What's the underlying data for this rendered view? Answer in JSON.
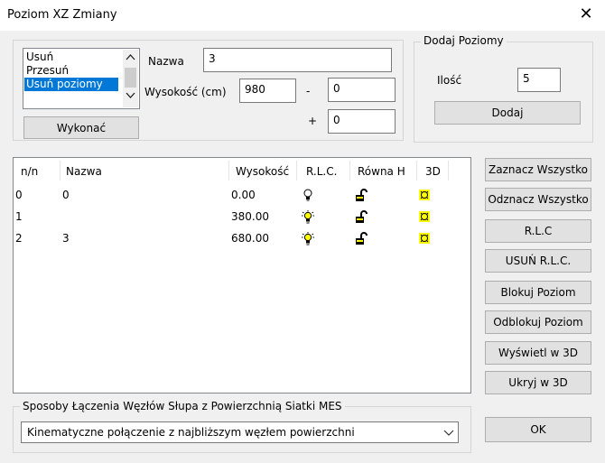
{
  "window": {
    "title": "Poziom XZ Zmiany",
    "close_glyph": "✕"
  },
  "ops": {
    "items": [
      "Usuń",
      "Przesuń",
      "Usuń poziomy"
    ],
    "selected_index": 2,
    "execute_label": "Wykonać"
  },
  "fields": {
    "name_label": "Nazwa",
    "name_value": "3",
    "height_label": "Wysokość (cm)",
    "height_value": "980",
    "minus_label": "-",
    "minus_value": "0",
    "plus_label": "+",
    "plus_value": "0"
  },
  "add_levels": {
    "group_label": "Dodaj Poziomy",
    "count_label": "Ilość",
    "count_value": "5",
    "add_label": "Dodaj"
  },
  "table": {
    "headers": {
      "nn": "n/n",
      "name": "Nazwa",
      "height": "Wysokość",
      "rlc": "R.L.C.",
      "equal_h": "Równa H",
      "three_d": "3D"
    },
    "rows": [
      {
        "nn": "0",
        "name": "0",
        "height": "0.00",
        "rlc": "bulb-off",
        "lock": "unlocked",
        "view3d": "shown"
      },
      {
        "nn": "1",
        "name": "",
        "height": "380.00",
        "rlc": "bulb-on",
        "lock": "unlocked",
        "view3d": "shown"
      },
      {
        "nn": "2",
        "name": "3",
        "height": "680.00",
        "rlc": "bulb-on",
        "lock": "unlocked",
        "view3d": "shown"
      }
    ]
  },
  "side_buttons": {
    "select_all": "Zaznacz Wszystko",
    "deselect_all": "Odznacz Wszystko",
    "rlc": "R.L.C",
    "delete_rlc": "USUŃ R.L.C.",
    "lock_level": "Blokuj Poziom",
    "unlock_level": "Odblokuj Poziom",
    "show_3d": "Wyświetl w 3D",
    "hide_3d": "Ukryj w 3D",
    "ok": "OK"
  },
  "connection": {
    "group_label": "Sposoby Łączenia Węzłów Słupa z Powierzchnią Siatki MES",
    "selected": "Kinematyczne połączenie z najbliższym węzłem powierzchni"
  },
  "colors": {
    "selection": "#0078d7",
    "icon_yellow": "#ffff00"
  }
}
